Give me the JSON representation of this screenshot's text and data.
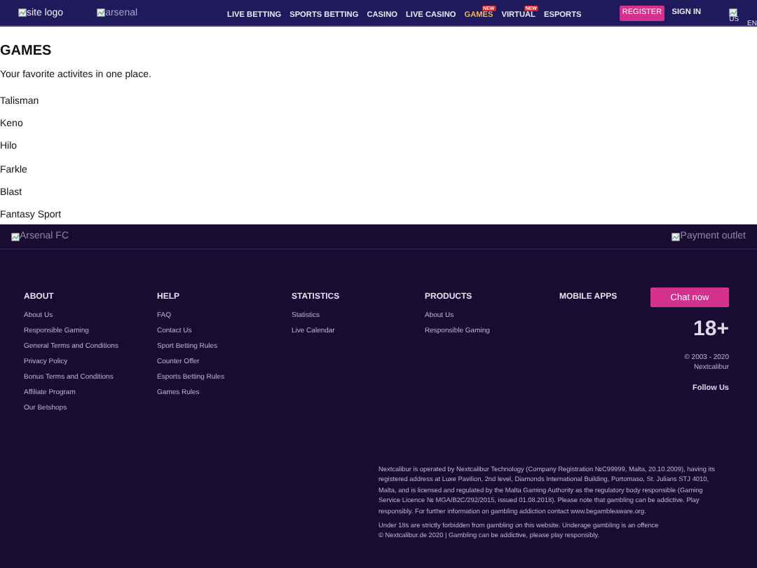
{
  "header": {
    "logo_alt": "site logo",
    "partner_alt": "arsenal",
    "nav": [
      {
        "label": "LIVE BETTING",
        "selected": false
      },
      {
        "label": "SPORTS BETTING",
        "selected": false
      },
      {
        "label": "CASINO",
        "selected": false
      },
      {
        "label": "LIVE CASINO",
        "selected": false
      },
      {
        "label": "GAMES",
        "selected": true,
        "badge": "NEW"
      },
      {
        "label": "VIRTUAL",
        "selected": false,
        "badge": "NEW"
      },
      {
        "label": "ESPORTS",
        "selected": false
      }
    ],
    "register": "REGISTER",
    "sign_in": "SIGN IN",
    "flag_alt": "US",
    "language": "EN"
  },
  "main": {
    "title": "GAMES",
    "subtitle": "Your favorite activites in one place.",
    "games": [
      "Talisman",
      "Keno",
      "Hilo",
      "Farkle",
      "Blast",
      "Fantasy Sport"
    ]
  },
  "footer": {
    "partner_alt": "Arsenal FC",
    "payment_alt": "Payment outlet",
    "columns": [
      {
        "heading": "ABOUT",
        "links": [
          "About Us",
          "Responsible Gaming",
          "General Terms and Conditions",
          "Privacy Policy",
          "Bonus Terms and Conditions",
          "Affiliate Program",
          "Our Betshops"
        ]
      },
      {
        "heading": "HELP",
        "links": [
          "FAQ",
          "Contact Us",
          "Sport Betting Rules",
          "Counter Offer",
          "Esports Betting Rules",
          "Games Rules"
        ]
      },
      {
        "heading": "STATISTICS",
        "links": [
          "Statistics",
          "Live Calendar"
        ]
      },
      {
        "heading": "PRODUCTS",
        "links": [
          "About Us",
          "Responsible Gaming"
        ]
      },
      {
        "heading": "MOBILE APPS"
      }
    ],
    "chat": "Chat now",
    "age": "18+",
    "copyright": [
      "© 2003 - 2020",
      "Nextcalibur"
    ],
    "follow": "Follow Us",
    "legal": [
      "Nextcalibur is operated by Nextcalibur Technology (Company Registration №C99999, Malta, 20.10.2009), having its registered address at Luxe Pavilion, 2nd level, Diamonds International Building, Portomaso, St. Julians STJ 4010, Malta, and is licensed and regulated by the Malta Gaming Authority as the regulatory body responsible (Gaming Service Licence № MGA/B2C/292/2015, issued 01.08.2018). Please note that gambling can be addictive. Play responsibly. For further information on gambling addiction contact www.begambleaware.org.",
      "Under 18s are strictly forbidden from gambling on this website. Underage gambling is an offence",
      "© Nextcalibur.de 2020 | Gambling can be addictive, please play responsibly."
    ]
  }
}
